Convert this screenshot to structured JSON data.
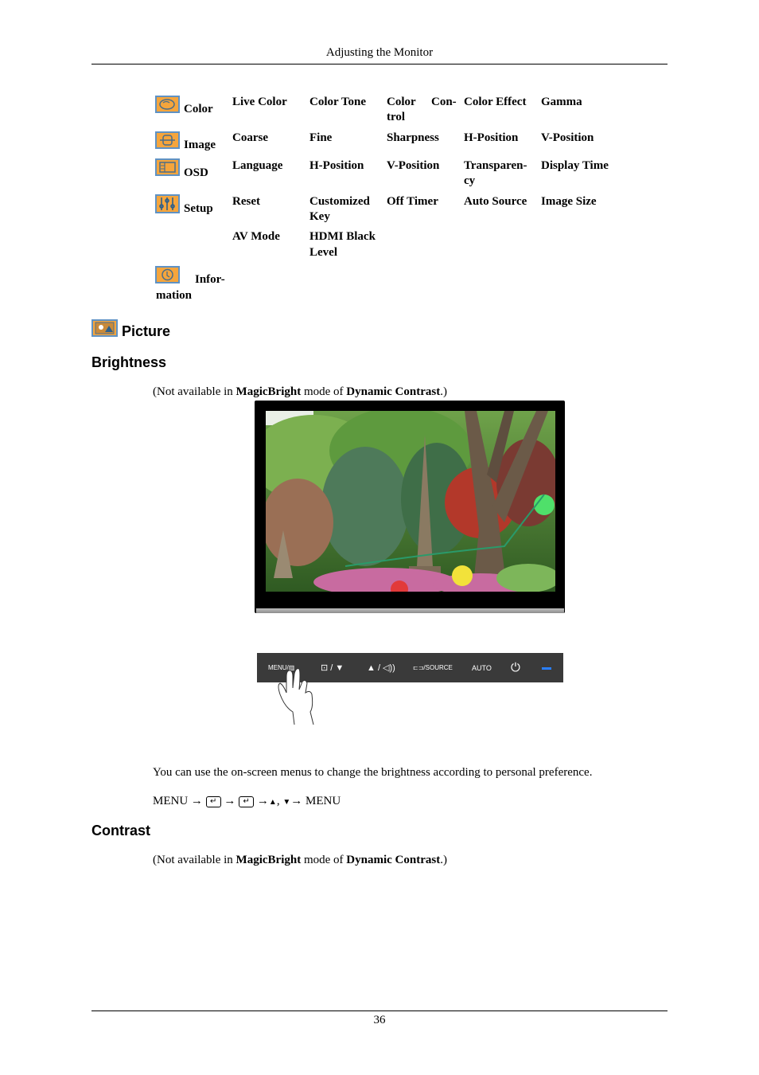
{
  "header": {
    "title": "Adjusting the Monitor"
  },
  "menu_table": {
    "rows": [
      {
        "icon": "color-icon",
        "label": "Color",
        "items": [
          "Live Color",
          "Color Tone",
          "Color Con-trol",
          "Color Effect",
          "Gamma"
        ]
      },
      {
        "icon": "image-icon",
        "label": "Image",
        "items": [
          "Coarse",
          "Fine",
          "Sharpness",
          "H-Position",
          "V-Position"
        ]
      },
      {
        "icon": "osd-icon",
        "label": "OSD",
        "items": [
          "Language",
          "H-Position",
          "V-Position",
          "Transparen-cy",
          "Display Time"
        ]
      },
      {
        "icon": "setup-icon",
        "label": "Setup",
        "items": [
          "Reset",
          "Customized Key",
          "Off Timer",
          "Auto Source",
          "Image Size"
        ]
      },
      {
        "icon": "",
        "label": "",
        "items": [
          "AV Mode",
          "HDMI Black Level"
        ]
      },
      {
        "icon": "information-icon",
        "label": "Infor-mation",
        "items": []
      }
    ],
    "cells": {
      "color_label": "Color",
      "color_1": "Live Color",
      "color_2": "Color Tone",
      "color_3a": "Color",
      "color_3b": "Con-",
      "color_3c": "trol",
      "color_4": "Color Effect",
      "color_5": "Gamma",
      "image_label": "Image",
      "image_1": "Coarse",
      "image_2": "Fine",
      "image_3": "Sharpness",
      "image_4": "H-Position",
      "image_5": "V-Position",
      "osd_label": "OSD",
      "osd_1": "Language",
      "osd_2": "H-Position",
      "osd_3": "V-Position",
      "osd_4a": "Transparen-",
      "osd_4b": "cy",
      "osd_5": "Display Time",
      "setup_label": "Setup",
      "setup_1": "Reset",
      "setup_2a": "Customized",
      "setup_2b": "Key",
      "setup_3": "Off Timer",
      "setup_4": "Auto Source",
      "setup_5": "Image Size",
      "extra_1": "AV Mode",
      "extra_2a": "HDMI Black",
      "extra_2b": "Level",
      "info_label_a": "Infor-",
      "info_label_b": "mation"
    }
  },
  "section": {
    "title": "Picture",
    "icon": "picture-icon"
  },
  "brightness": {
    "heading": "Brightness",
    "note_prefix": "(Not available in ",
    "note_bold1": "MagicBright",
    "note_mid": " mode of ",
    "note_bold2": "Dynamic Contrast",
    "note_suffix": ".)",
    "description": "You can use the on-screen menus to change the brightness according to personal preference.",
    "sequence": {
      "start": "MENU",
      "arrow": "→",
      "enter": "↵",
      "up": "▲",
      "comma": ",",
      "down": "▼",
      "end": "MENU"
    }
  },
  "button_bar": {
    "menu": "MENU/▥",
    "enter_down": "⊡ / ▼",
    "up_volume": "▲ / ◁))",
    "source": "⊏⊐/SOURCE",
    "auto": "AUTO",
    "power": "⏻",
    "indicator_color": "#2a7fff"
  },
  "contrast": {
    "heading": "Contrast",
    "note_prefix": "(Not available in ",
    "note_bold1": "MagicBright",
    "note_mid": " mode of ",
    "note_bold2": "Dynamic Contrast",
    "note_suffix": ".)"
  },
  "footer": {
    "page_number": "36"
  }
}
